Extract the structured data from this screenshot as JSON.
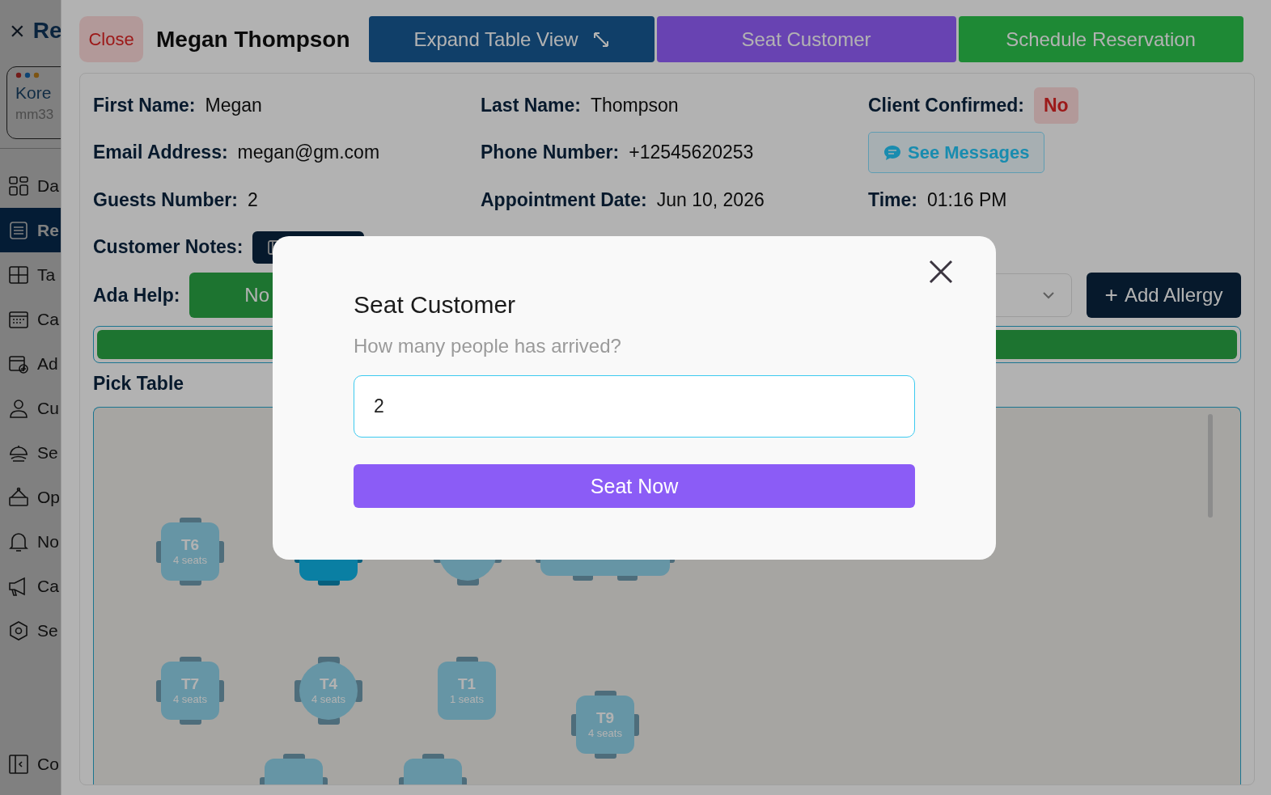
{
  "sidebar": {
    "close": "×",
    "title": "Re",
    "account": {
      "name": "Kore",
      "handle": "mm33"
    },
    "items": [
      {
        "label": "Da",
        "selected": false
      },
      {
        "label": "Re",
        "selected": true
      },
      {
        "label": "Ta",
        "selected": false
      },
      {
        "label": "Ca",
        "selected": false
      },
      {
        "label": "Ad",
        "selected": false
      },
      {
        "label": "Cu",
        "selected": false
      },
      {
        "label": "Se",
        "selected": false
      },
      {
        "label": "Op",
        "selected": false
      },
      {
        "label": "No",
        "selected": false
      },
      {
        "label": "Ca",
        "selected": false
      },
      {
        "label": "Se",
        "selected": false
      }
    ],
    "footer": {
      "label": "Co"
    }
  },
  "header": {
    "close": "Close",
    "name": "Megan Thompson",
    "buttons": [
      {
        "label": "Expand Table View",
        "kind": "expand"
      },
      {
        "label": "Seat Customer",
        "kind": "seat"
      },
      {
        "label": "Schedule Reservation",
        "kind": "schedule"
      }
    ]
  },
  "details": [
    {
      "label": "First Name:",
      "value": "Megan"
    },
    {
      "label": "Last Name:",
      "value": "Thompson"
    },
    {
      "label": "Client Confirmed:",
      "value": "No",
      "kind": "badge"
    },
    {
      "label": "Email Address:",
      "value": "megan@gm.com"
    },
    {
      "label": "Phone Number:",
      "value": "+12545620253"
    },
    {
      "value": "See Messages",
      "kind": "messages"
    },
    {
      "label": "Guests Number:",
      "value": "2"
    },
    {
      "label": "Appointment Date:",
      "value": "Jun 10, 2026"
    },
    {
      "label": "Time:",
      "value": "01:16 PM"
    }
  ],
  "customer_notes": {
    "label": "Customer Notes:"
  },
  "ada_help": {
    "label": "Ada Help:",
    "value": "No"
  },
  "add_allergy": {
    "icon": "+",
    "label": "Add Allergy"
  },
  "pick_table": {
    "title": "Pick Table",
    "tables": [
      {
        "label": "T6",
        "seats": "4 seats",
        "kind": "square",
        "selected": false
      },
      {
        "kind": "square",
        "selected": true
      },
      {
        "kind": "round",
        "selected": false
      },
      {
        "kind": "wide",
        "selected": false
      },
      {
        "label": "T7",
        "seats": "4 seats",
        "kind": "square",
        "selected": false
      },
      {
        "label": "T4",
        "seats": "4 seats",
        "kind": "round",
        "selected": false
      },
      {
        "label": "T1",
        "seats": "1 seats",
        "kind": "single",
        "selected": false
      },
      {
        "label": "T9",
        "seats": "4 seats",
        "kind": "square",
        "selected": false
      },
      {
        "kind": "square",
        "selected": false
      },
      {
        "kind": "square",
        "selected": false
      }
    ]
  },
  "modal": {
    "title": "Seat Customer",
    "prompt": "How many people has arrived?",
    "value": "2",
    "submit": "Seat Now"
  }
}
